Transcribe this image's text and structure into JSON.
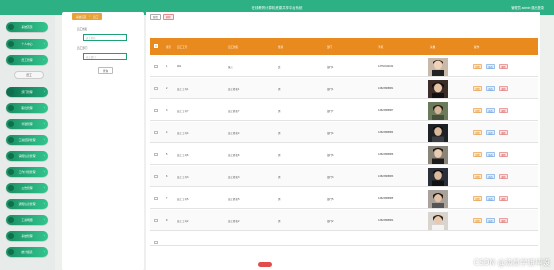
{
  "header": {
    "title": "在线教育计算机资源共享平台系统",
    "user": "管理员 admin  退出登录"
  },
  "sidebar": {
    "items": [
      {
        "label": "系统首页"
      },
      {
        "label": "个人中心"
      },
      {
        "label": "员工管理"
      },
      {
        "label": "员工"
      },
      {
        "label": "部门管理"
      },
      {
        "label": "职位管理"
      },
      {
        "label": "考勤管理"
      },
      {
        "label": "工资结算管理"
      },
      {
        "label": "请假信息管理"
      },
      {
        "label": "工作计划管理"
      },
      {
        "label": "公告管理"
      },
      {
        "label": "通知信息管理"
      },
      {
        "label": "工资明细"
      },
      {
        "label": "系统管理"
      },
      {
        "label": "统计报表"
      }
    ]
  },
  "breadcrumb": {
    "home": "系统首页",
    "current": "员工"
  },
  "search": {
    "name_label": "员工姓名",
    "name_placeholder": "员工姓名",
    "dept_label": "员工部门",
    "dept_placeholder": "员工部门",
    "query_button": "查询"
  },
  "toolbar": {
    "add": "新增",
    "delete": "删除"
  },
  "table": {
    "headers": [
      "索引",
      "员工工号",
      "员工姓名",
      "性别",
      "部门",
      "手机",
      "头像",
      "操作"
    ],
    "actions": {
      "detail": "详情",
      "edit": "修改",
      "delete": "删除"
    },
    "rows": [
      {
        "index": "1",
        "id": "001",
        "name": "张三",
        "gender": "女",
        "dept": "部门1",
        "phone": "13752032032"
      },
      {
        "index": "2",
        "id": "员工工号1",
        "name": "员工姓名1",
        "gender": "男",
        "dept": "部门1",
        "phone": "13823888881"
      },
      {
        "index": "3",
        "id": "员工工号7",
        "name": "员工姓名7",
        "gender": "男",
        "dept": "部门7",
        "phone": "13823888887"
      },
      {
        "index": "4",
        "id": "员工工号4",
        "name": "员工姓名4",
        "gender": "男",
        "dept": "部门4",
        "phone": "13823888884"
      },
      {
        "index": "5",
        "id": "员工工号6",
        "name": "员工姓名6",
        "gender": "男",
        "dept": "部门6",
        "phone": "13823888886"
      },
      {
        "index": "6",
        "id": "员工工号3",
        "name": "员工姓名3",
        "gender": "男",
        "dept": "部门3",
        "phone": "13823888883"
      },
      {
        "index": "7",
        "id": "员工工号5",
        "name": "员工姓名5",
        "gender": "男",
        "dept": "部门5",
        "phone": "13823888885"
      },
      {
        "index": "8",
        "id": "员工工号2",
        "name": "员工姓名2",
        "gender": "男",
        "dept": "部门2",
        "phone": "13823888882"
      }
    ]
  },
  "watermark": "CSDN @演员学姐毕设",
  "colors": {
    "brand": "#2db083",
    "header": "#e98a1e"
  }
}
